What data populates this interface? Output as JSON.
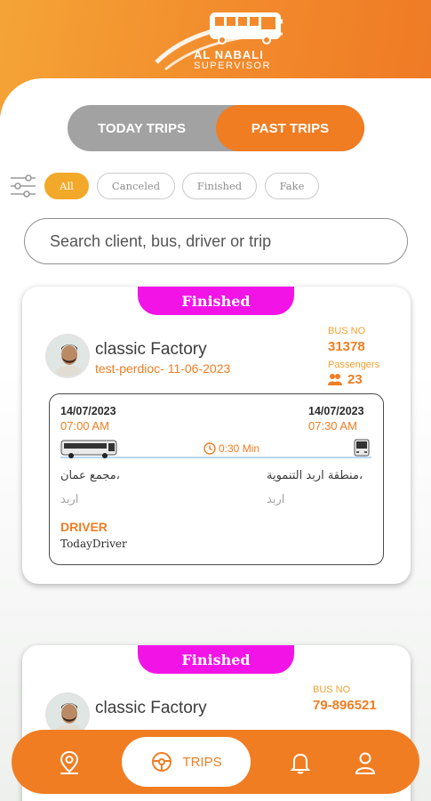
{
  "app": {
    "brand_title": "AL NABALI",
    "brand_subtitle": "SUPERVISOR"
  },
  "tabs": [
    {
      "label": "TODAY TRIPS",
      "active": false
    },
    {
      "label": "PAST TRIPS",
      "active": true
    }
  ],
  "filters": [
    {
      "label": "All",
      "active": true
    },
    {
      "label": "Canceled",
      "active": false
    },
    {
      "label": "Finished",
      "active": false
    },
    {
      "label": "Fake",
      "active": false
    }
  ],
  "search": {
    "placeholder": "Search client, bus, driver or trip"
  },
  "trips": [
    {
      "status": "Finished",
      "client": "classic Factory",
      "trip": "test-perdioc- 11-06-2023",
      "bus_no_label": "BUS NO",
      "bus_no": "31378",
      "passengers_label": "Passengers",
      "passengers": "23",
      "start_date": "14/07/2023",
      "start_time": "07:00 AM",
      "end_date": "14/07/2023",
      "end_time": "07:30 AM",
      "duration": "0:30 Min",
      "from_place": "مجمع عمان،",
      "from_city": "اربد",
      "to_place": "منطقة اربد التنموية،",
      "to_city": "اربد",
      "driver_label": "DRIVER",
      "driver": "TodayDriver"
    },
    {
      "status": "Finished",
      "client": "classic Factory",
      "bus_no_label": "BUS NO",
      "bus_no": "79-896521"
    }
  ],
  "nav": {
    "trips_label": "TRIPS"
  },
  "colors": {
    "accent": "#f07d22",
    "finished_badge": "#f214e6",
    "chip_active": "#f2a92a"
  }
}
